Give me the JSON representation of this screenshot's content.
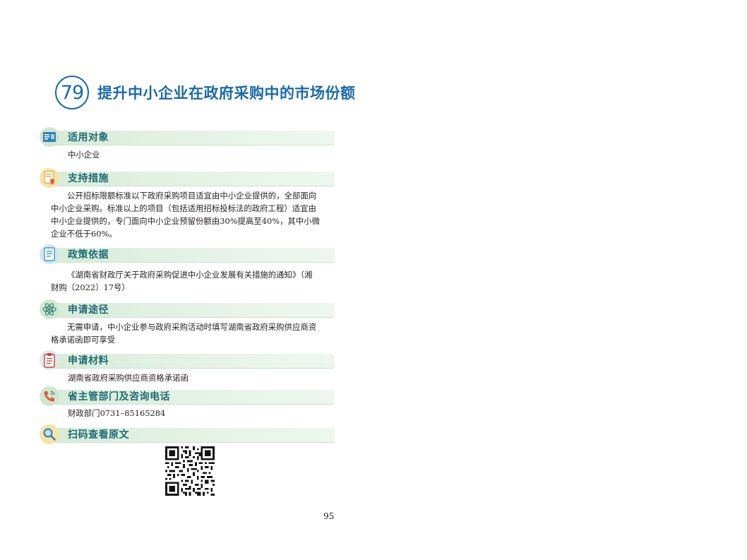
{
  "title": {
    "number": "79",
    "text": "提升中小企业在政府采购中的市场份额"
  },
  "sections": {
    "target": {
      "label": "适用对象",
      "text": "中小企业",
      "icon": "id-card-icon"
    },
    "measures": {
      "label": "支持措施",
      "lines": [
        "公开招标限额标准以下政府采购项目适宜由中小企业提供的，全部面向",
        "中小企业采购。标准以上的项目（包括适用招标投标法的政府工程）适宜由",
        "中小企业提供的，专门面向中小企业预留份额由30%提高至40%，其中小微",
        "企业不低于60%。"
      ],
      "icon": "certificate-icon"
    },
    "basis": {
      "label": "政策依据",
      "lines": [
        "《湖南省财政厅关于政府采购促进中小企业发展有关措施的通知》（湘",
        "财购〔2022〕17号）"
      ],
      "icon": "document-icon"
    },
    "approach": {
      "label": "申请途径",
      "lines": [
        "无需申请，中小企业参与政府采购活动时填写湖南省政府采购供应商资",
        "格承诺函即可享受"
      ],
      "icon": "atom-icon"
    },
    "materials": {
      "label": "申请材料",
      "text": "湖南省政府采购供应商资格承诺函",
      "icon": "clipboard-icon"
    },
    "contact": {
      "label": "省主管部门及咨询电话",
      "text": "财政部门0731–85165284",
      "icon": "phone-icon"
    },
    "scan": {
      "label": "扫码查看原文",
      "icon": "magnifier-icon"
    }
  },
  "page_number": "95",
  "colors": {
    "title": "#1a6aa8",
    "section_label": "#1f6c74",
    "section_bar": "#d7ecd9"
  }
}
